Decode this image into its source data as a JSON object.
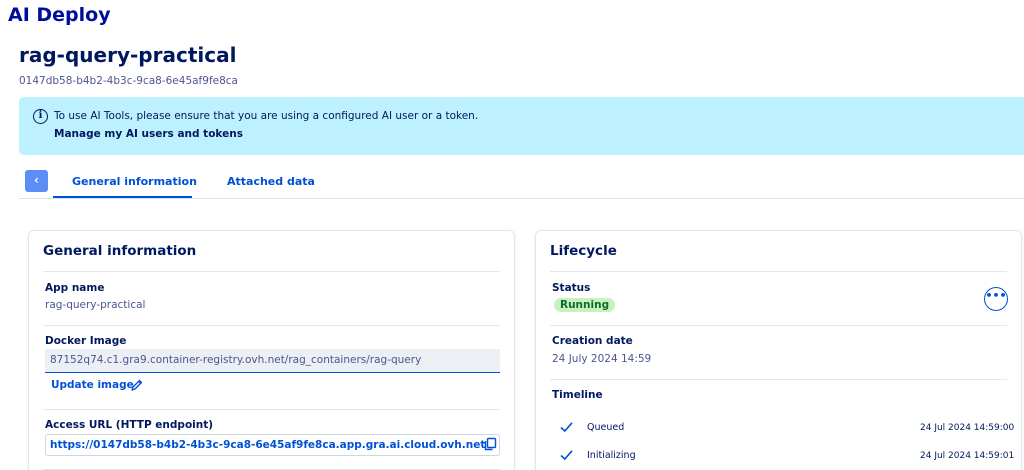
{
  "app": {
    "title": "AI Deploy"
  },
  "page": {
    "title": "rag-query-practical",
    "id": "0147db58-b4b2-4b3c-9ca8-6e45af9fe8ca"
  },
  "banner": {
    "text": "To use AI Tools, please ensure that you are using a configured AI user or a token.",
    "link": "Manage my AI users and tokens"
  },
  "tabs": [
    {
      "label": "General information",
      "active": true
    },
    {
      "label": "Attached data",
      "active": false
    }
  ],
  "general": {
    "title": "General information",
    "app_name_label": "App name",
    "app_name_value": "rag-query-practical",
    "docker_label": "Docker Image",
    "docker_value": "87152q74.c1.gra9.container-registry.ovh.net/rag_containers/rag-query",
    "update_image": "Update image",
    "url_label": "Access URL (HTTP endpoint)",
    "url_value": "https://0147db58-b4b2-4b3c-9ca8-6e45af9fe8ca.app.gra.ai.cloud.ovh.net"
  },
  "lifecycle": {
    "title": "Lifecycle",
    "status_label": "Status",
    "status_value": "Running",
    "creation_label": "Creation date",
    "creation_value": "24 July 2024 14:59",
    "timeline_label": "Timeline",
    "timeline": [
      {
        "label": "Queued",
        "time": "24 Jul 2024 14:59:00"
      },
      {
        "label": "Initializing",
        "time": "24 Jul 2024 14:59:01"
      }
    ]
  },
  "colors": {
    "accent": "#0050d7",
    "banner": "#bef1ff",
    "status_running": "#c6f2c0",
    "back_button": "#5d8ef8"
  },
  "icons": [
    "info-icon",
    "chevron-left-icon",
    "pencil-icon",
    "copy-icon",
    "ellipsis-icon",
    "check-icon"
  ]
}
